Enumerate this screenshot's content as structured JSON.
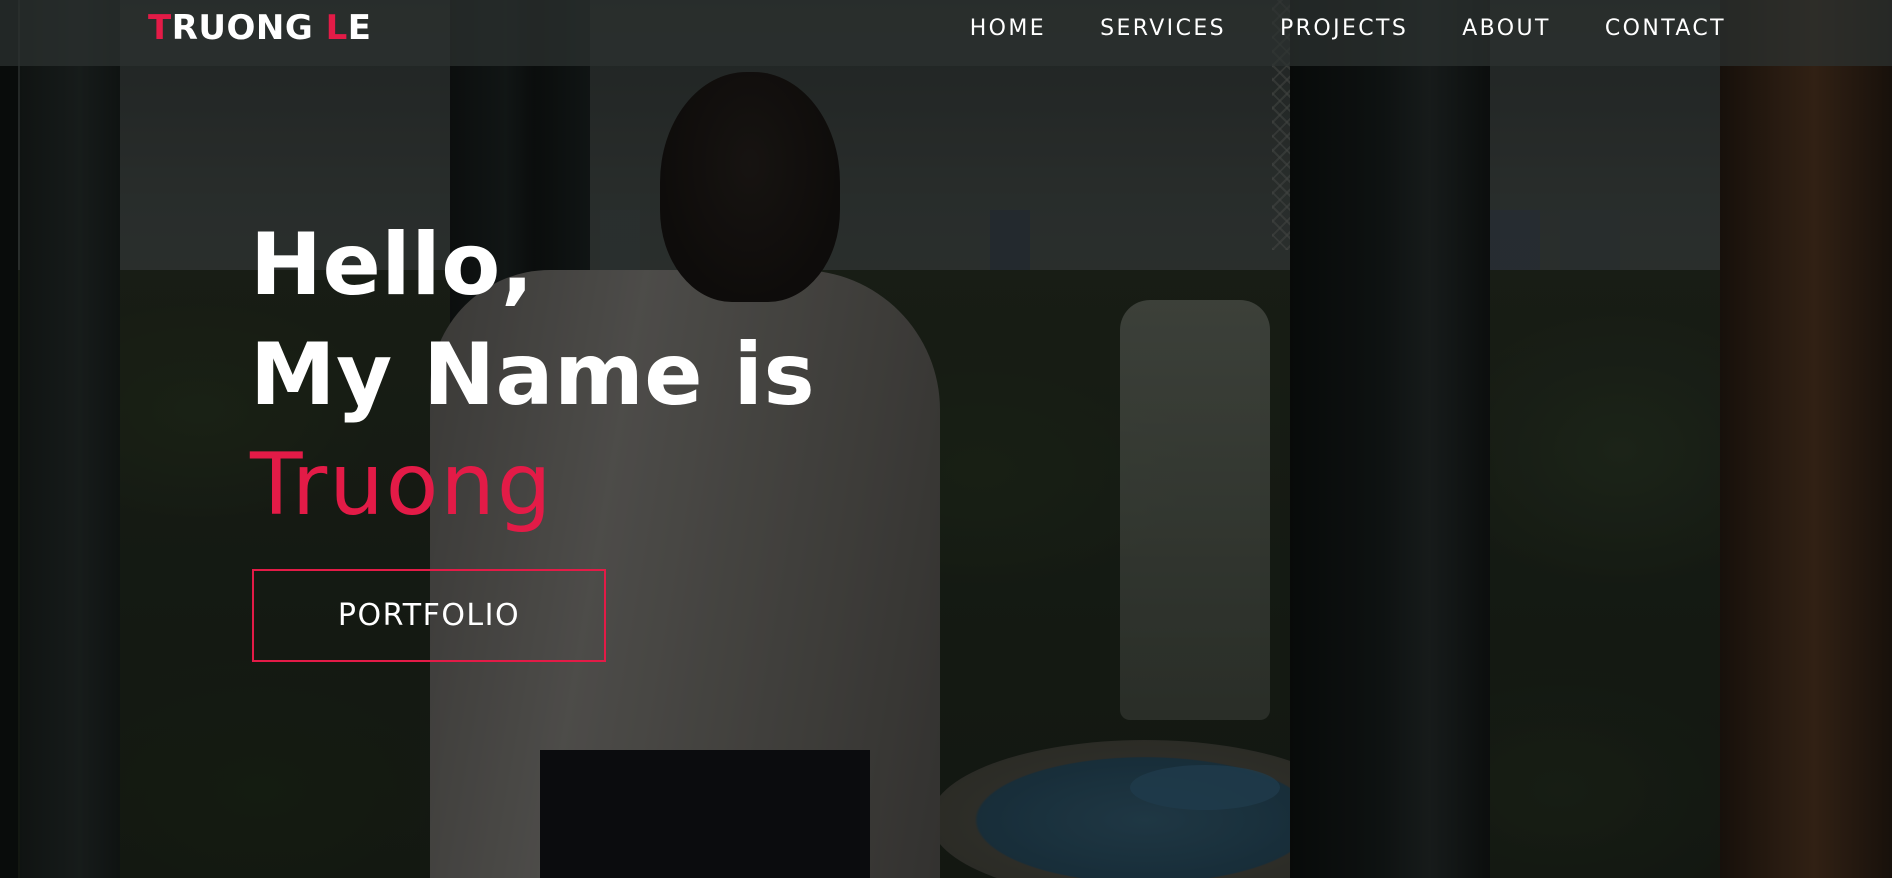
{
  "brand": {
    "first_initial": "T",
    "first_rest": "RUONG ",
    "last_initial": "L",
    "last_rest": "E"
  },
  "nav": {
    "items": [
      {
        "label": "HOME"
      },
      {
        "label": "SERVICES"
      },
      {
        "label": "PROJECTS"
      },
      {
        "label": "ABOUT"
      },
      {
        "label": "CONTACT"
      }
    ]
  },
  "hero": {
    "line1": "Hello,",
    "line2": "My Name is",
    "name": "Truong",
    "button_label": "PORTFOLIO"
  },
  "colors": {
    "accent": "#e31b47",
    "text": "#ffffff",
    "navbar": "#2d3231"
  }
}
